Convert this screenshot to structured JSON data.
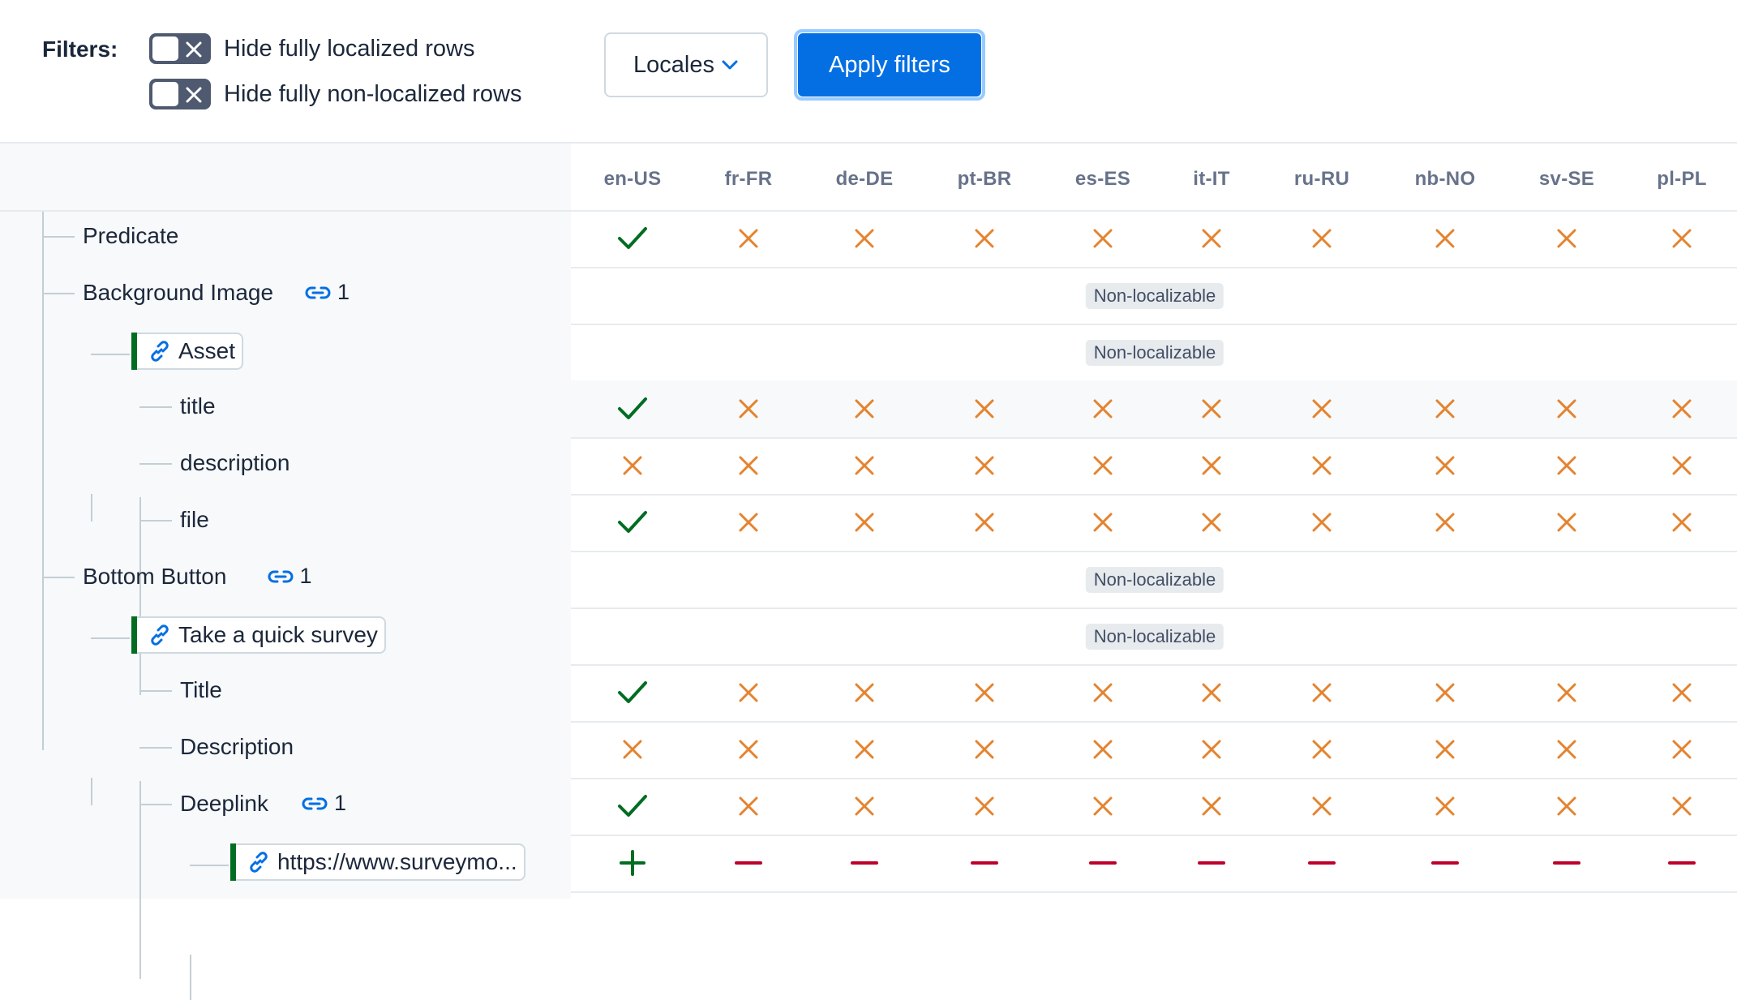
{
  "filters": {
    "label": "Filters:",
    "toggles": [
      {
        "label": "Hide fully localized rows",
        "checked": false
      },
      {
        "label": "Hide fully non-localized rows",
        "checked": false
      }
    ],
    "locales_button": "Locales",
    "apply_button": "Apply filters"
  },
  "locales": [
    "en-US",
    "fr-FR",
    "de-DE",
    "pt-BR",
    "es-ES",
    "it-IT",
    "ru-RU",
    "nb-NO",
    "sv-SE",
    "pl-PL"
  ],
  "nonlocalizable_label": "Non-localizable",
  "tree": [
    {
      "label": "Predicate",
      "kind": "field",
      "level": 1
    },
    {
      "label": "Background Image",
      "kind": "field",
      "level": 1,
      "ref_count": "1"
    },
    {
      "label": "Asset",
      "kind": "entry",
      "level": 2
    },
    {
      "label": "title",
      "kind": "field",
      "level": 3
    },
    {
      "label": "description",
      "kind": "field",
      "level": 3
    },
    {
      "label": "file",
      "kind": "field",
      "level": 3
    },
    {
      "label": "Bottom Button",
      "kind": "field",
      "level": 1,
      "ref_count": "1"
    },
    {
      "label": "Take a quick survey",
      "kind": "entry",
      "level": 2
    },
    {
      "label": "Title",
      "kind": "field",
      "level": 3
    },
    {
      "label": "Description",
      "kind": "field",
      "level": 3
    },
    {
      "label": "Deeplink",
      "kind": "field",
      "level": 3,
      "ref_count": "1"
    },
    {
      "label": "https://www.surveymo...",
      "kind": "entry",
      "level": 4
    }
  ],
  "status_rows": [
    [
      "check",
      "cross",
      "cross",
      "cross",
      "cross",
      "cross",
      "cross",
      "cross",
      "cross",
      "cross"
    ],
    "nonlocalizable",
    "nonlocalizable",
    [
      "check",
      "cross",
      "cross",
      "cross",
      "cross",
      "cross",
      "cross",
      "cross",
      "cross",
      "cross"
    ],
    [
      "cross",
      "cross",
      "cross",
      "cross",
      "cross",
      "cross",
      "cross",
      "cross",
      "cross",
      "cross"
    ],
    [
      "check",
      "cross",
      "cross",
      "cross",
      "cross",
      "cross",
      "cross",
      "cross",
      "cross",
      "cross"
    ],
    "nonlocalizable",
    "nonlocalizable",
    [
      "check",
      "cross",
      "cross",
      "cross",
      "cross",
      "cross",
      "cross",
      "cross",
      "cross",
      "cross"
    ],
    [
      "cross",
      "cross",
      "cross",
      "cross",
      "cross",
      "cross",
      "cross",
      "cross",
      "cross",
      "cross"
    ],
    [
      "check",
      "cross",
      "cross",
      "cross",
      "cross",
      "cross",
      "cross",
      "cross",
      "cross",
      "cross"
    ],
    [
      "plus",
      "minus",
      "minus",
      "minus",
      "minus",
      "minus",
      "minus",
      "minus",
      "minus",
      "minus"
    ]
  ],
  "status_icons": {
    "check": "check-icon",
    "cross": "cross-icon",
    "plus": "plus-icon",
    "minus": "minus-icon"
  },
  "colors": {
    "check": "#006d23",
    "cross": "#e4832f",
    "plus": "#006d23",
    "minus": "#bd002a",
    "link": "#036fe3",
    "primary": "#036fe3",
    "entry_bar": "#006d23"
  }
}
